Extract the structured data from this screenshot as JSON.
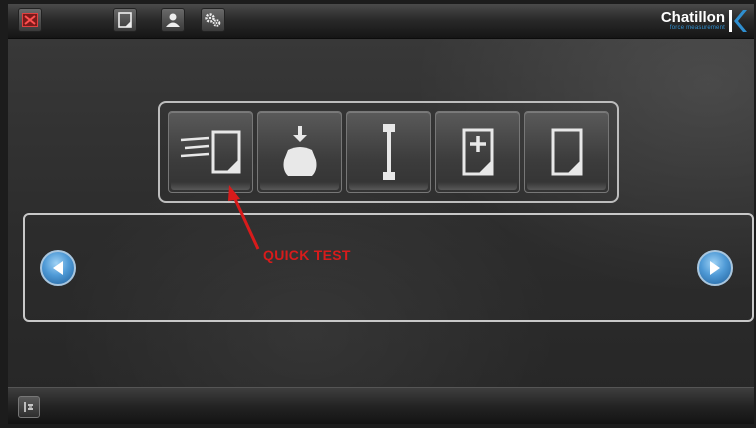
{
  "app": {
    "brand_name": "Chatillon",
    "brand_tagline": "force measurement",
    "brand_color": "#2f8fd0"
  },
  "topbar": {
    "buttons": [
      {
        "name": "close-icon",
        "color": "#d93030"
      },
      {
        "name": "document-icon"
      },
      {
        "name": "user-icon"
      },
      {
        "name": "settings-gears-icon"
      }
    ]
  },
  "tools": [
    {
      "name": "quick-test-icon"
    },
    {
      "name": "compression-test-icon"
    },
    {
      "name": "tensile-test-icon"
    },
    {
      "name": "new-test-icon"
    },
    {
      "name": "test-document-icon"
    }
  ],
  "annotation": {
    "label": "QUICK TEST",
    "color": "#d81b1b"
  },
  "panel": {
    "prev": "left-arrow-icon",
    "next": "right-arrow-icon"
  },
  "bottombar": {
    "button": "menu-toggle-icon"
  }
}
